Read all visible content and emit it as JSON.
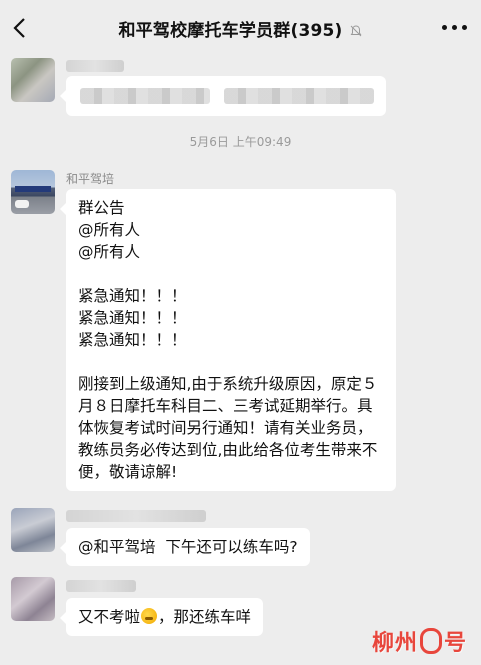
{
  "header": {
    "title": "和平驾校摩托车学员群(395)",
    "back_icon": "chevron-left-icon",
    "mute_icon": "bell-muted-icon",
    "more_icon": "more-dots-icon"
  },
  "timestamp": "5月6日 上午09:49",
  "messages": {
    "announcement": {
      "sender": "和平驾培",
      "lines": [
        "群公告",
        "@所有人",
        "@所有人",
        "",
        "紧急通知！！！",
        "紧急通知！！！",
        "紧急通知！！！",
        ""
      ],
      "body": "刚接到上级通知,由于系统升级原因，原定５月８日摩托车科目二、三考试延期举行。具体恢复考试时间另行通知！请有关业务员，教练员务必传达到位,由此给各位考生带来不便，敬请谅解!"
    },
    "reply1": {
      "text": "@和平驾培  下午还可以练车吗?"
    },
    "reply2": {
      "text_before": "又不考啦",
      "text_after": "，那还练车咩",
      "emoji": "face-emoji"
    }
  },
  "watermark": {
    "left": "柳州",
    "right": "号"
  },
  "colors": {
    "background": "#ededed",
    "bubble": "#ffffff",
    "watermark": "#e8463c"
  }
}
